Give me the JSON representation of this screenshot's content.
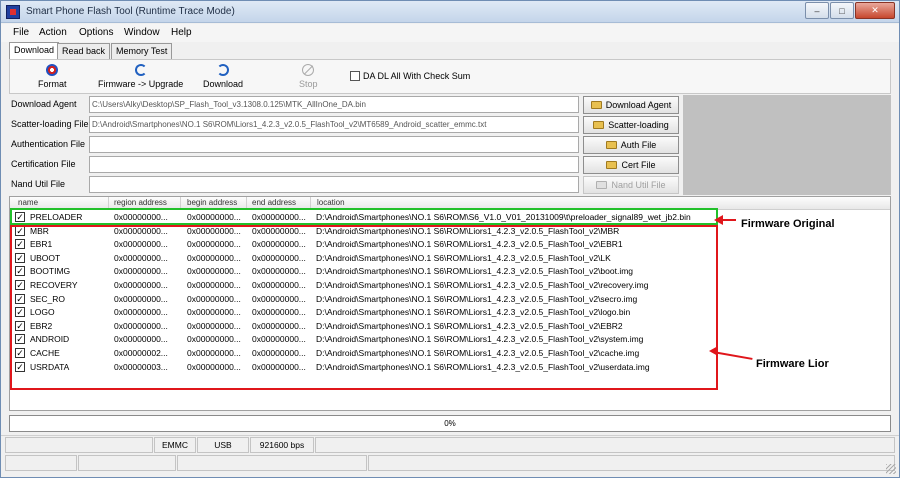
{
  "window": {
    "title": "Smart Phone Flash Tool (Runtime Trace Mode)"
  },
  "menu": [
    "File",
    "Action",
    "Options",
    "Window",
    "Help"
  ],
  "tabs": [
    "Download",
    "Read back",
    "Memory Test"
  ],
  "toolbar": {
    "format": "Format",
    "firmware_upgrade": "Firmware -> Upgrade",
    "download": "Download",
    "stop": "Stop",
    "checksum_label": "DA DL All With Check Sum"
  },
  "files": [
    {
      "label": "Download Agent",
      "value": "C:\\Users\\Alky\\Desktop\\SP_Flash_Tool_v3.1308.0.125\\MTK_AllInOne_DA.bin",
      "button": "Download Agent"
    },
    {
      "label": "Scatter-loading File",
      "value": "D:\\Android\\Smartphones\\NO.1 S6\\ROM\\Liors1_4.2.3_v2.0.5_FlashTool_v2\\MT6589_Android_scatter_emmc.txt",
      "button": "Scatter-loading"
    },
    {
      "label": "Authentication File",
      "value": "",
      "button": "Auth File"
    },
    {
      "label": "Certification File",
      "value": "",
      "button": "Cert File"
    },
    {
      "label": "Nand Util File",
      "value": "",
      "button": "Nand Util File"
    }
  ],
  "table": {
    "headers": [
      "name",
      "region address",
      "begin address",
      "end address",
      "location"
    ],
    "rows": [
      {
        "name": "PRELOADER",
        "region": "0x00000000...",
        "begin": "0x00000000...",
        "end": "0x00000000...",
        "location": "D:\\Android\\Smartphones\\NO.1 S6\\ROM\\S6_V1.0_V01_20131009\\t\\preloader_signal89_wet_jb2.bin"
      },
      {
        "name": "MBR",
        "region": "0x00000000...",
        "begin": "0x00000000...",
        "end": "0x00000000...",
        "location": "D:\\Android\\Smartphones\\NO.1 S6\\ROM\\Liors1_4.2.3_v2.0.5_FlashTool_v2\\MBR"
      },
      {
        "name": "EBR1",
        "region": "0x00000000...",
        "begin": "0x00000000...",
        "end": "0x00000000...",
        "location": "D:\\Android\\Smartphones\\NO.1 S6\\ROM\\Liors1_4.2.3_v2.0.5_FlashTool_v2\\EBR1"
      },
      {
        "name": "UBOOT",
        "region": "0x00000000...",
        "begin": "0x00000000...",
        "end": "0x00000000...",
        "location": "D:\\Android\\Smartphones\\NO.1 S6\\ROM\\Liors1_4.2.3_v2.0.5_FlashTool_v2\\LK"
      },
      {
        "name": "BOOTIMG",
        "region": "0x00000000...",
        "begin": "0x00000000...",
        "end": "0x00000000...",
        "location": "D:\\Android\\Smartphones\\NO.1 S6\\ROM\\Liors1_4.2.3_v2.0.5_FlashTool_v2\\boot.img"
      },
      {
        "name": "RECOVERY",
        "region": "0x00000000...",
        "begin": "0x00000000...",
        "end": "0x00000000...",
        "location": "D:\\Android\\Smartphones\\NO.1 S6\\ROM\\Liors1_4.2.3_v2.0.5_FlashTool_v2\\recovery.img"
      },
      {
        "name": "SEC_RO",
        "region": "0x00000000...",
        "begin": "0x00000000...",
        "end": "0x00000000...",
        "location": "D:\\Android\\Smartphones\\NO.1 S6\\ROM\\Liors1_4.2.3_v2.0.5_FlashTool_v2\\secro.img"
      },
      {
        "name": "LOGO",
        "region": "0x00000000...",
        "begin": "0x00000000...",
        "end": "0x00000000...",
        "location": "D:\\Android\\Smartphones\\NO.1 S6\\ROM\\Liors1_4.2.3_v2.0.5_FlashTool_v2\\logo.bin"
      },
      {
        "name": "EBR2",
        "region": "0x00000000...",
        "begin": "0x00000000...",
        "end": "0x00000000...",
        "location": "D:\\Android\\Smartphones\\NO.1 S6\\ROM\\Liors1_4.2.3_v2.0.5_FlashTool_v2\\EBR2"
      },
      {
        "name": "ANDROID",
        "region": "0x00000000...",
        "begin": "0x00000000...",
        "end": "0x00000000...",
        "location": "D:\\Android\\Smartphones\\NO.1 S6\\ROM\\Liors1_4.2.3_v2.0.5_FlashTool_v2\\system.img"
      },
      {
        "name": "CACHE",
        "region": "0x00000002...",
        "begin": "0x00000000...",
        "end": "0x00000000...",
        "location": "D:\\Android\\Smartphones\\NO.1 S6\\ROM\\Liors1_4.2.3_v2.0.5_FlashTool_v2\\cache.img"
      },
      {
        "name": "USRDATA",
        "region": "0x00000003...",
        "begin": "0x00000000...",
        "end": "0x00000000...",
        "location": "D:\\Android\\Smartphones\\NO.1 S6\\ROM\\Liors1_4.2.3_v2.0.5_FlashTool_v2\\userdata.img"
      }
    ]
  },
  "annotations": {
    "original": "Firmware Original",
    "lior": "Firmware Lior"
  },
  "progress": {
    "value": 0,
    "label": "0%"
  },
  "status": {
    "storage": "EMMC",
    "port": "USB",
    "baud": "921600 bps"
  },
  "colors": {
    "green_box": "#22c02a",
    "red_box": "#e0161b"
  }
}
